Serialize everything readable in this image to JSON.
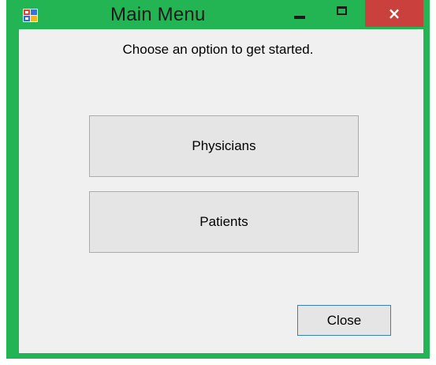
{
  "window": {
    "title": "Main Menu",
    "icon": "app-window-icon",
    "controls": {
      "minimize": "minimize-icon",
      "maximize": "maximize-icon",
      "close": "×"
    },
    "colors": {
      "frame": "#23b454",
      "close_button": "#c9403d",
      "client_background": "#f0f0f0",
      "button_face": "#e5e5e5",
      "default_button_border": "#3c7fb1"
    }
  },
  "content": {
    "prompt": "Choose an option to get started.",
    "buttons": [
      {
        "label": "Physicians"
      },
      {
        "label": "Patients"
      }
    ],
    "close_label": "Close"
  }
}
